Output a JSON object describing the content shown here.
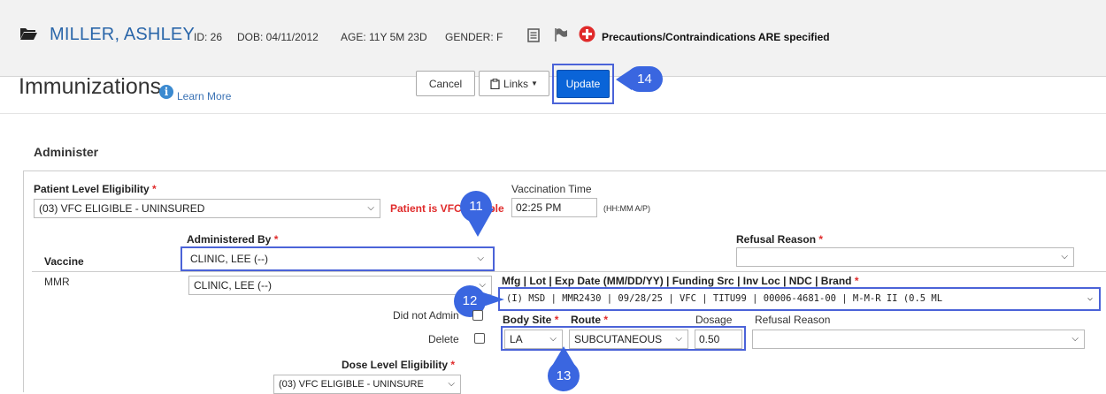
{
  "header": {
    "patient_name": "MILLER, ASHLEY",
    "id": "ID: 26",
    "dob": "DOB: 04/11/2012",
    "age": "AGE: 11Y 5M 23D",
    "gender": "GENDER: F",
    "precautions": "Precautions/Contraindications ARE specified"
  },
  "page": {
    "title": "Immunizations",
    "learn_more": "Learn More"
  },
  "toolbar": {
    "cancel": "Cancel",
    "links": "Links",
    "update": "Update"
  },
  "section_title": "Administer",
  "form": {
    "patient_eligibility_label": "Patient Level Eligibility",
    "patient_eligibility_value": "(03) VFC ELIGIBLE - UNINSURED",
    "vfc_status": "Patient is VFC",
    "vfc_status_tail": "ible",
    "vacc_time_label": "Vaccination Time",
    "vacc_time_value": "02:25 PM",
    "vacc_time_hint": "(HH:MM A/P)",
    "administered_by_label": "Administered By",
    "administered_by_value": "CLINIC, LEE (--)",
    "refusal_reason_label": "Refusal Reason",
    "vaccine_label": "Vaccine",
    "vaccine_name": "MMR",
    "row_administered_by": "CLINIC, LEE (--)",
    "mfg_label": "Mfg | Lot | Exp Date (MM/DD/YY) | Funding Src | Inv Loc | NDC | Brand",
    "mfg_value": "(I) MSD | MMR2430       | 09/28/25 | VFC      | TITU99 | 00006-4681-00 | M-M-R II (0.5 ML",
    "did_not_admin_label": "Did not Admin",
    "delete_label": "Delete",
    "body_site_label": "Body Site",
    "body_site_value": "LA",
    "route_label": "Route",
    "route_value": "SUBCUTANEOUS",
    "dosage_label": "Dosage",
    "dosage_value": "0.50",
    "row_refusal_label": "Refusal Reason",
    "dose_eligibility_label": "Dose Level Eligibility",
    "dose_eligibility_value": "(03) VFC ELIGIBLE - UNINSURE"
  },
  "callouts": {
    "c11": "11",
    "c12": "12",
    "c13": "13",
    "c14": "14"
  },
  "colors": {
    "accent": "#0a64d8",
    "highlight": "#4b63d8",
    "name": "#2a66a9",
    "warning": "#e02b2b"
  },
  "icons": [
    "folder-icon",
    "notes-icon",
    "flag-icon",
    "alert-plus-icon",
    "info-icon",
    "clipboard-icon",
    "chevron-down-icon"
  ]
}
